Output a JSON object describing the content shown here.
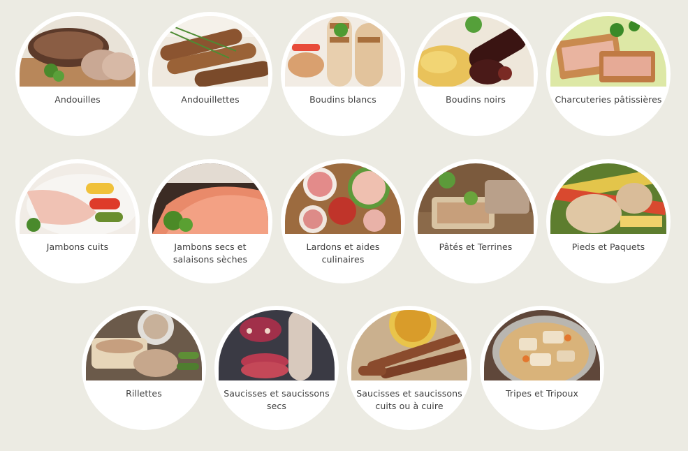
{
  "categories": [
    {
      "label": "Andouilles",
      "icon": "andouille-sausage-photo"
    },
    {
      "label": "Andouillettes",
      "icon": "andouillette-sausage-photo"
    },
    {
      "label": "Boudins blancs",
      "icon": "white-pudding-photo"
    },
    {
      "label": "Boudins noirs",
      "icon": "black-pudding-photo"
    },
    {
      "label": "Charcuteries pâtissières",
      "icon": "pastry-charcuterie-photo"
    },
    {
      "label": "Jambons cuits",
      "icon": "cooked-ham-photo"
    },
    {
      "label": "Jambons secs et salaisons sèches",
      "icon": "dry-ham-photo"
    },
    {
      "label": "Lardons et aides culinaires",
      "icon": "lardons-photo"
    },
    {
      "label": "Pâtés et Terrines",
      "icon": "pate-terrine-photo"
    },
    {
      "label": "Pieds et Paquets",
      "icon": "pieds-paquets-photo"
    },
    {
      "label": "Rillettes",
      "icon": "rillettes-photo"
    },
    {
      "label": "Saucisses et saucissons secs",
      "icon": "dry-sausage-photo"
    },
    {
      "label": "Saucisses et saucissons cuits ou à cuire",
      "icon": "cooked-sausage-photo"
    },
    {
      "label": "Tripes et Tripoux",
      "icon": "tripes-photo"
    }
  ],
  "colors": {
    "background": "#ecebe3",
    "card": "#ffffff",
    "text": "#3f3f3f"
  }
}
